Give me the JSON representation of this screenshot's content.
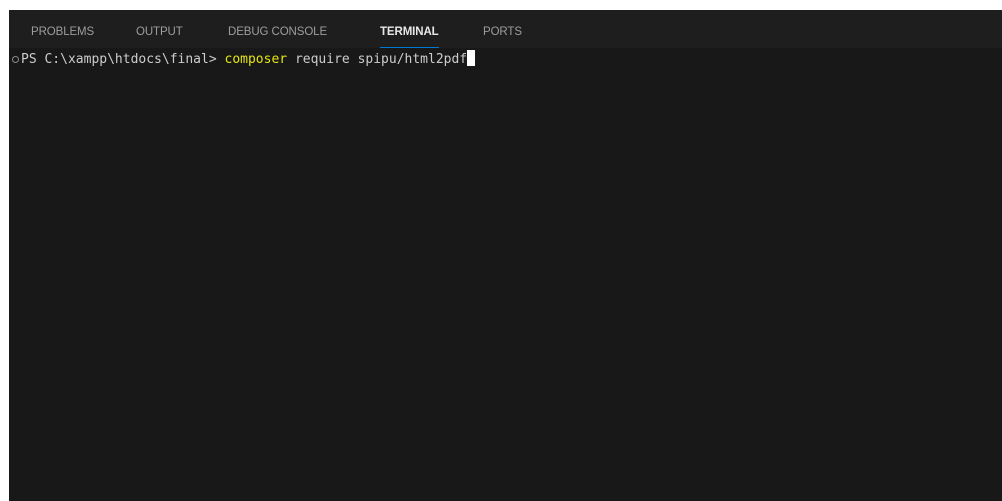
{
  "panel": {
    "tabs": [
      {
        "label": "PROBLEMS",
        "active": false
      },
      {
        "label": "OUTPUT",
        "active": false
      },
      {
        "label": "DEBUG CONSOLE",
        "active": false
      },
      {
        "label": "TERMINAL",
        "active": true
      },
      {
        "label": "PORTS",
        "active": false
      }
    ],
    "accent_color": "#0078d4"
  },
  "terminal": {
    "prompt": "PS C:\\xampp\\htdocs\\final> ",
    "command": "composer",
    "arguments": " require spipu/html2pdf",
    "command_color": "#e5e510",
    "text_color": "#cccccc",
    "background": "#181818"
  }
}
